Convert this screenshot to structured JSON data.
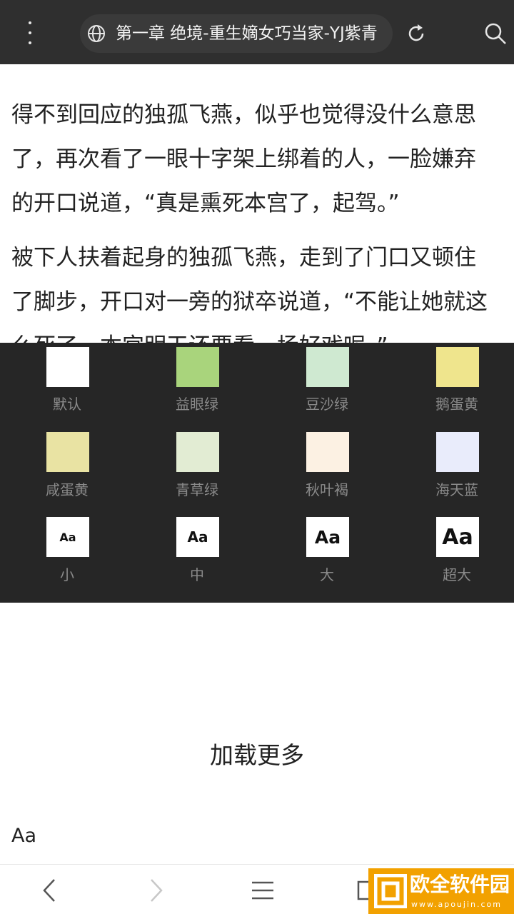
{
  "browser": {
    "title": "第一章 绝境-重生嫡女巧当家-YJ紫青"
  },
  "article": {
    "paragraphs": [
      [
        "得不到回应的独孤飞燕，似乎也觉得没什么意思",
        "了，再次看了一眼十字架上绑着的人，一脸嫌弃",
        "的开口说道，“真是熏死本宫了，起驾。”"
      ],
      [
        "被下人扶着起身的独孤飞燕，走到了门口又顿住",
        "了脚步，开口对一旁的狱卒说道，“不能让她就这",
        "么死了，本宫明天还要看一场好戏呢。”"
      ]
    ]
  },
  "theme_panel": {
    "colors": [
      {
        "label": "默认",
        "color": "#ffffff"
      },
      {
        "label": "益眼绿",
        "color": "#a9d47c"
      },
      {
        "label": "豆沙绿",
        "color": "#cfe9d1"
      },
      {
        "label": "鹅蛋黄",
        "color": "#efe58d"
      },
      {
        "label": "咸蛋黄",
        "color": "#e9e3a3"
      },
      {
        "label": "青草绿",
        "color": "#e2ecd3"
      },
      {
        "label": "秋叶褐",
        "color": "#fcf1e3"
      },
      {
        "label": "海天蓝",
        "color": "#e9ecfb"
      }
    ],
    "font_sizes": [
      {
        "label": "小",
        "sample": "Aa"
      },
      {
        "label": "中",
        "sample": "Aa"
      },
      {
        "label": "大",
        "sample": "Aa"
      },
      {
        "label": "超大",
        "sample": "Aa"
      }
    ]
  },
  "load_more": "加载更多",
  "font_toggle": "Aa",
  "bottom_nav": {
    "icons": [
      "back-icon",
      "forward-icon",
      "menu-icon",
      "tabs-icon",
      "home-icon"
    ]
  },
  "watermark": {
    "text": "欧全软件园",
    "sub": "www.apoujin.com"
  }
}
